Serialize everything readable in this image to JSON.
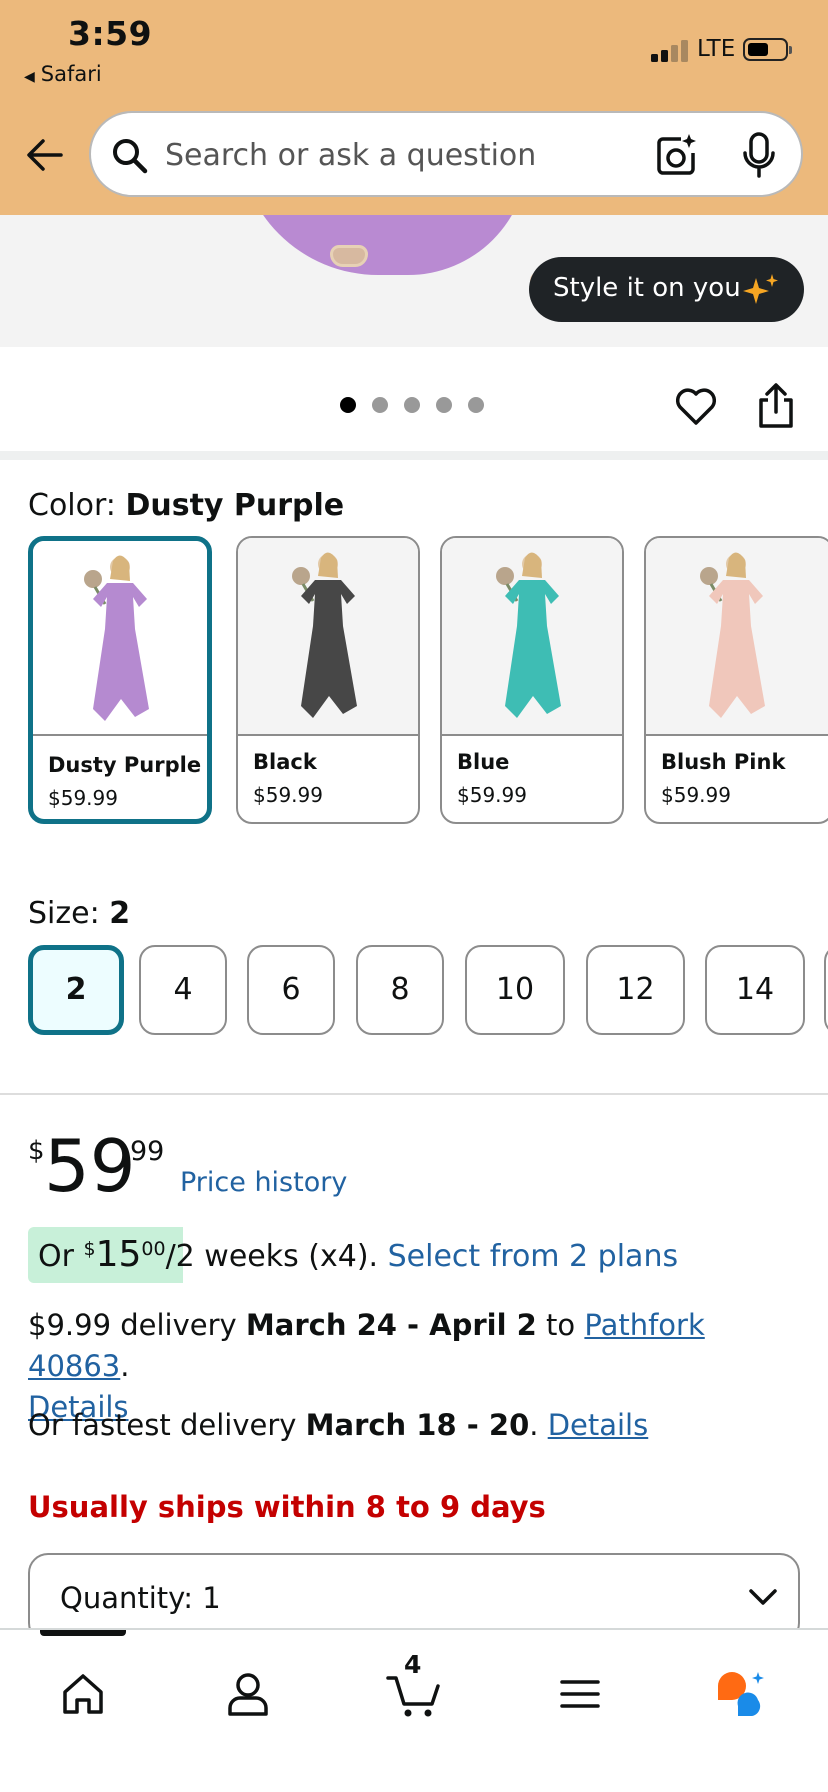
{
  "status_bar": {
    "time": "3:59",
    "back_app": "Safari",
    "network": "LTE"
  },
  "header": {
    "search_placeholder": "Search or ask a question",
    "icons": [
      "back-arrow-icon",
      "search-icon",
      "camera-icon",
      "microphone-icon"
    ]
  },
  "gallery": {
    "style_button": "Style it on you",
    "dot_count": 5,
    "active_dot": 0
  },
  "color": {
    "label": "Color: ",
    "selected": "Dusty Purple",
    "options": [
      {
        "name": "Dusty Purple",
        "price": "$59.99",
        "swatch": "#b58ad0"
      },
      {
        "name": "Black",
        "price": "$59.99",
        "swatch": "#474747"
      },
      {
        "name": "Blue",
        "price": "$59.99",
        "swatch": "#3ebdb4"
      },
      {
        "name": "Blush Pink",
        "price": "$59.99",
        "swatch": "#f0c7bb"
      }
    ]
  },
  "size": {
    "label": "Size: ",
    "selected": "2",
    "options": [
      "2",
      "4",
      "6",
      "8",
      "10",
      "12",
      "14"
    ]
  },
  "price": {
    "currency": "$",
    "whole": "59",
    "fraction": "99",
    "history_link": "Price history"
  },
  "installments": {
    "or": "Or ",
    "currency": "$",
    "whole": "15",
    "fraction": "00",
    "period": "/2 weeks (x4). ",
    "plans_link": "Select from 2 plans"
  },
  "delivery": {
    "cost_prefix": "$9.99 delivery ",
    "dates": "March 24 - April 2",
    "to": " to ",
    "location": "Pathfork 40863",
    "period": ".",
    "details": "Details"
  },
  "fastest": {
    "prefix": "Or fastest delivery ",
    "dates": "March 18 - 20",
    "period": ". ",
    "details": "Details"
  },
  "shipping_note": "Usually ships within 8 to 9 days",
  "quantity": {
    "label": "Quantity: ",
    "value": "1"
  },
  "bottom_nav": {
    "cart_count": "4",
    "items": [
      "home-icon",
      "account-icon",
      "cart-icon",
      "menu-icon",
      "rufus-icon"
    ]
  }
}
